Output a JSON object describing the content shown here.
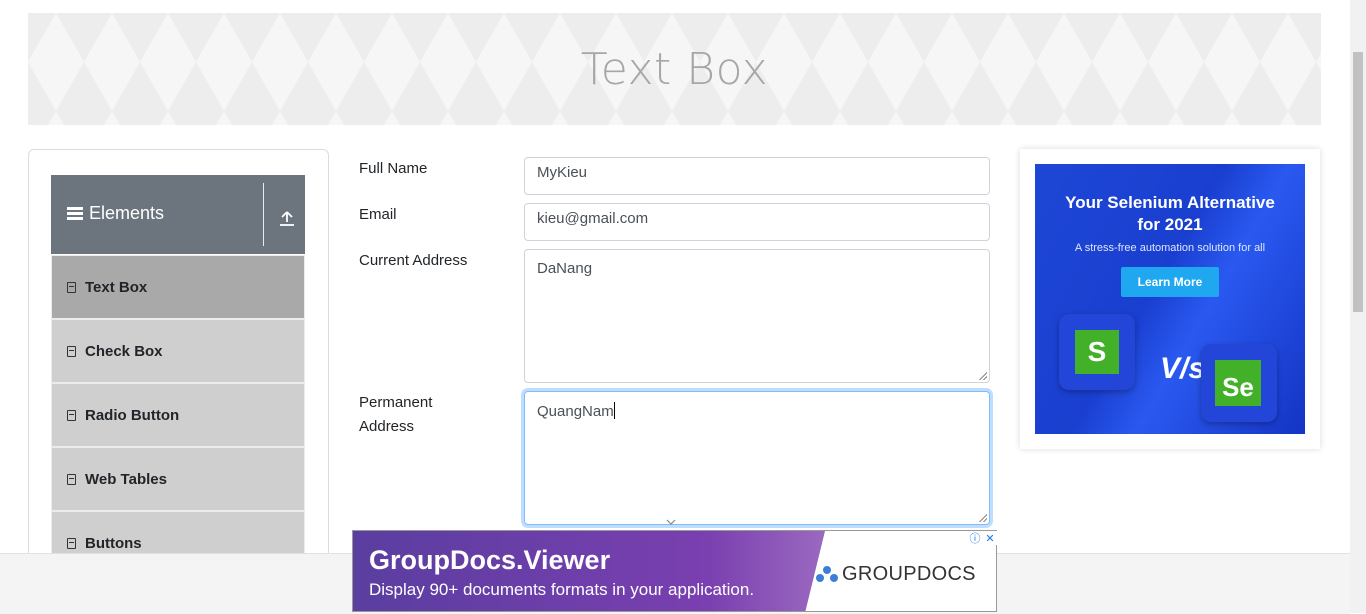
{
  "page": {
    "title": "Text Box"
  },
  "sidebar": {
    "group_title": "Elements",
    "items": [
      {
        "label": "Text Box",
        "active": true
      },
      {
        "label": "Check Box"
      },
      {
        "label": "Radio Button"
      },
      {
        "label": "Web Tables"
      },
      {
        "label": "Buttons"
      }
    ]
  },
  "form": {
    "full_name": {
      "label": "Full Name",
      "value": "MyKieu"
    },
    "email": {
      "label": "Email",
      "value": "kieu@gmail.com"
    },
    "current_address": {
      "label": "Current Address",
      "value": "DaNang"
    },
    "permanent_address": {
      "label_line1": "Permanent",
      "label_line2": "Address",
      "value": "QuangNam"
    }
  },
  "ad_right": {
    "headline_line1": "Your Selenium Alternative",
    "headline_line2": "for 2021",
    "subtext": "A stress-free automation solution for all",
    "cta": "Learn More",
    "logo_left_letter": "S",
    "vs": "V/s",
    "logo_right_letters": "Se"
  },
  "ad_bottom": {
    "title": "GroupDocs.Viewer",
    "subtitle": "Display 90+ documents formats in your application.",
    "brand": "GROUPDOCS",
    "info_symbol": "ⓘ",
    "close_symbol": "✕"
  },
  "colors": {
    "sidebar_header": "#6c757d",
    "menu_item": "#cfcfcf",
    "menu_item_active": "#a9a9a9",
    "focus_border": "#80bdff",
    "ad_blue": "#1e47d6",
    "ad_green": "#43b02a"
  }
}
